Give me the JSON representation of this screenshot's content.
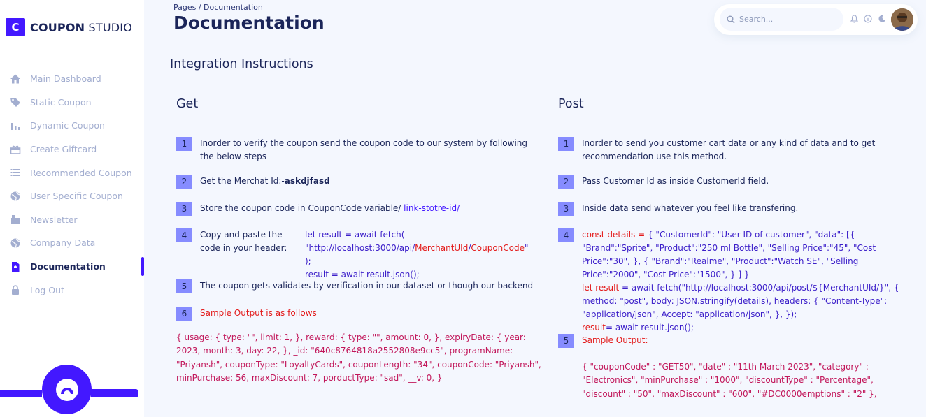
{
  "brand": {
    "logo_letter": "C",
    "name_bold": "COUPON",
    "name_rest": " STUDIO",
    "accent": "#4318ff"
  },
  "sidebar": {
    "items": [
      {
        "label": "Main Dashboard",
        "icon": "home-icon"
      },
      {
        "label": "Static Coupon",
        "icon": "tag-icon"
      },
      {
        "label": "Dynamic Coupon",
        "icon": "bar-chart-icon"
      },
      {
        "label": "Create Giftcard",
        "icon": "gift-icon"
      },
      {
        "label": "Recommended Coupon",
        "icon": "list-icon"
      },
      {
        "label": "User Specific Coupon",
        "icon": "globe-icon"
      },
      {
        "label": "Newsletter",
        "icon": "newsletter-icon"
      },
      {
        "label": "Company Data",
        "icon": "globe-icon"
      },
      {
        "label": "Documentation",
        "icon": "document-icon",
        "active": true
      },
      {
        "label": "Log Out",
        "icon": "lock-icon"
      }
    ]
  },
  "header": {
    "breadcrumb": "Pages  /  Documentation",
    "title": "Documentation",
    "search_placeholder": "Search..."
  },
  "main": {
    "section_title": "Integration Instructions",
    "get": {
      "title": "Get",
      "step1": "Inorder to verify the coupon send the coupon code to our system by following the below steps",
      "step2_prefix": "Get the Merchat Id:-",
      "step2_value": "askdjfasd",
      "step3_prefix": "Store the coupon code in CouponCode variable/ ",
      "step3_link": "link-stotre-id/",
      "step4_label": "Copy and paste the code in your header:",
      "step4_code_line1": "let result = await fetch(",
      "step4_code_line2_a": "\"http://localhost:3000/api/",
      "step4_code_line2_b": "MerchantUId",
      "step4_code_line2_c": "/",
      "step4_code_line2_d": "CouponCode",
      "step4_code_line2_e": "\" );",
      "step4_code_line3": "result = await result.json();",
      "step5": "The coupon gets validates by verification in our dataset or though our backend",
      "step6": "Sample Output is as follows",
      "sample_output": "{ usage: { type: \"\", limit: 1, }, reward: { type: \"\", amount: 0, }, expiryDate: { year: 2023, month: 3, day: 22, }, _id: \"640c8764818a2552808e9cc5\", programName: \"Priyansh\", couponType: \"LoyaltyCards\", couponLength: \"34\", couponCode: \"Priyansh\", minPurchase: 56, maxDiscount: 7, porductType: \"sad\", __v: 0, }"
    },
    "post": {
      "title": "Post",
      "step1": "Inorder to send you customer cart data or any kind of data and to get recommendation use this method.",
      "step2": "Pass Customer Id as inside CustomerId field.",
      "step3": "Inside data send whatever you feel like transfering.",
      "step4_const": "const details = ",
      "step4_obj": " { \"CustomerId\": \"User ID of customer\", \"data\": [{ \"Brand\":\"Sprite\", \"Product\":\"250 ml Bottle\", \"Selling Price\":\"45\", \"Cost Price\":\"30\", }, { \"Brand\":\"Realme\", \"Product\":\"Watch SE\", \"Selling Price\":\"2000\", \"Cost Price\":\"1500\", } ] }",
      "step4_let": "let result",
      "step4_fetch": " = await fetch(\"http://localhost:3000/api/post/${MerchantUId/}\", { method: \"post\", body: JSON.stringify(details), headers: { \"Content-Type\": \"application/json\", Accept: \"application/json\", }, });",
      "step4_result": "result",
      "step4_result_rest": "= await result.json();",
      "step5": "Sample Output:",
      "sample_output": "{ \"couponCode\" : \"GET50\", \"date\" : \"11th March 2023\", \"category\" : \"Electronics\", \"minPurchase\" : \"1000\", \"discountType\" : \"Percentage\", \"discount\" : \"50\", \"maxDiscount\" : \"600\", \"#DC0000emptions\" : \"2\" },"
    },
    "step_numbers": [
      "1",
      "2",
      "3",
      "4",
      "5",
      "6"
    ]
  }
}
